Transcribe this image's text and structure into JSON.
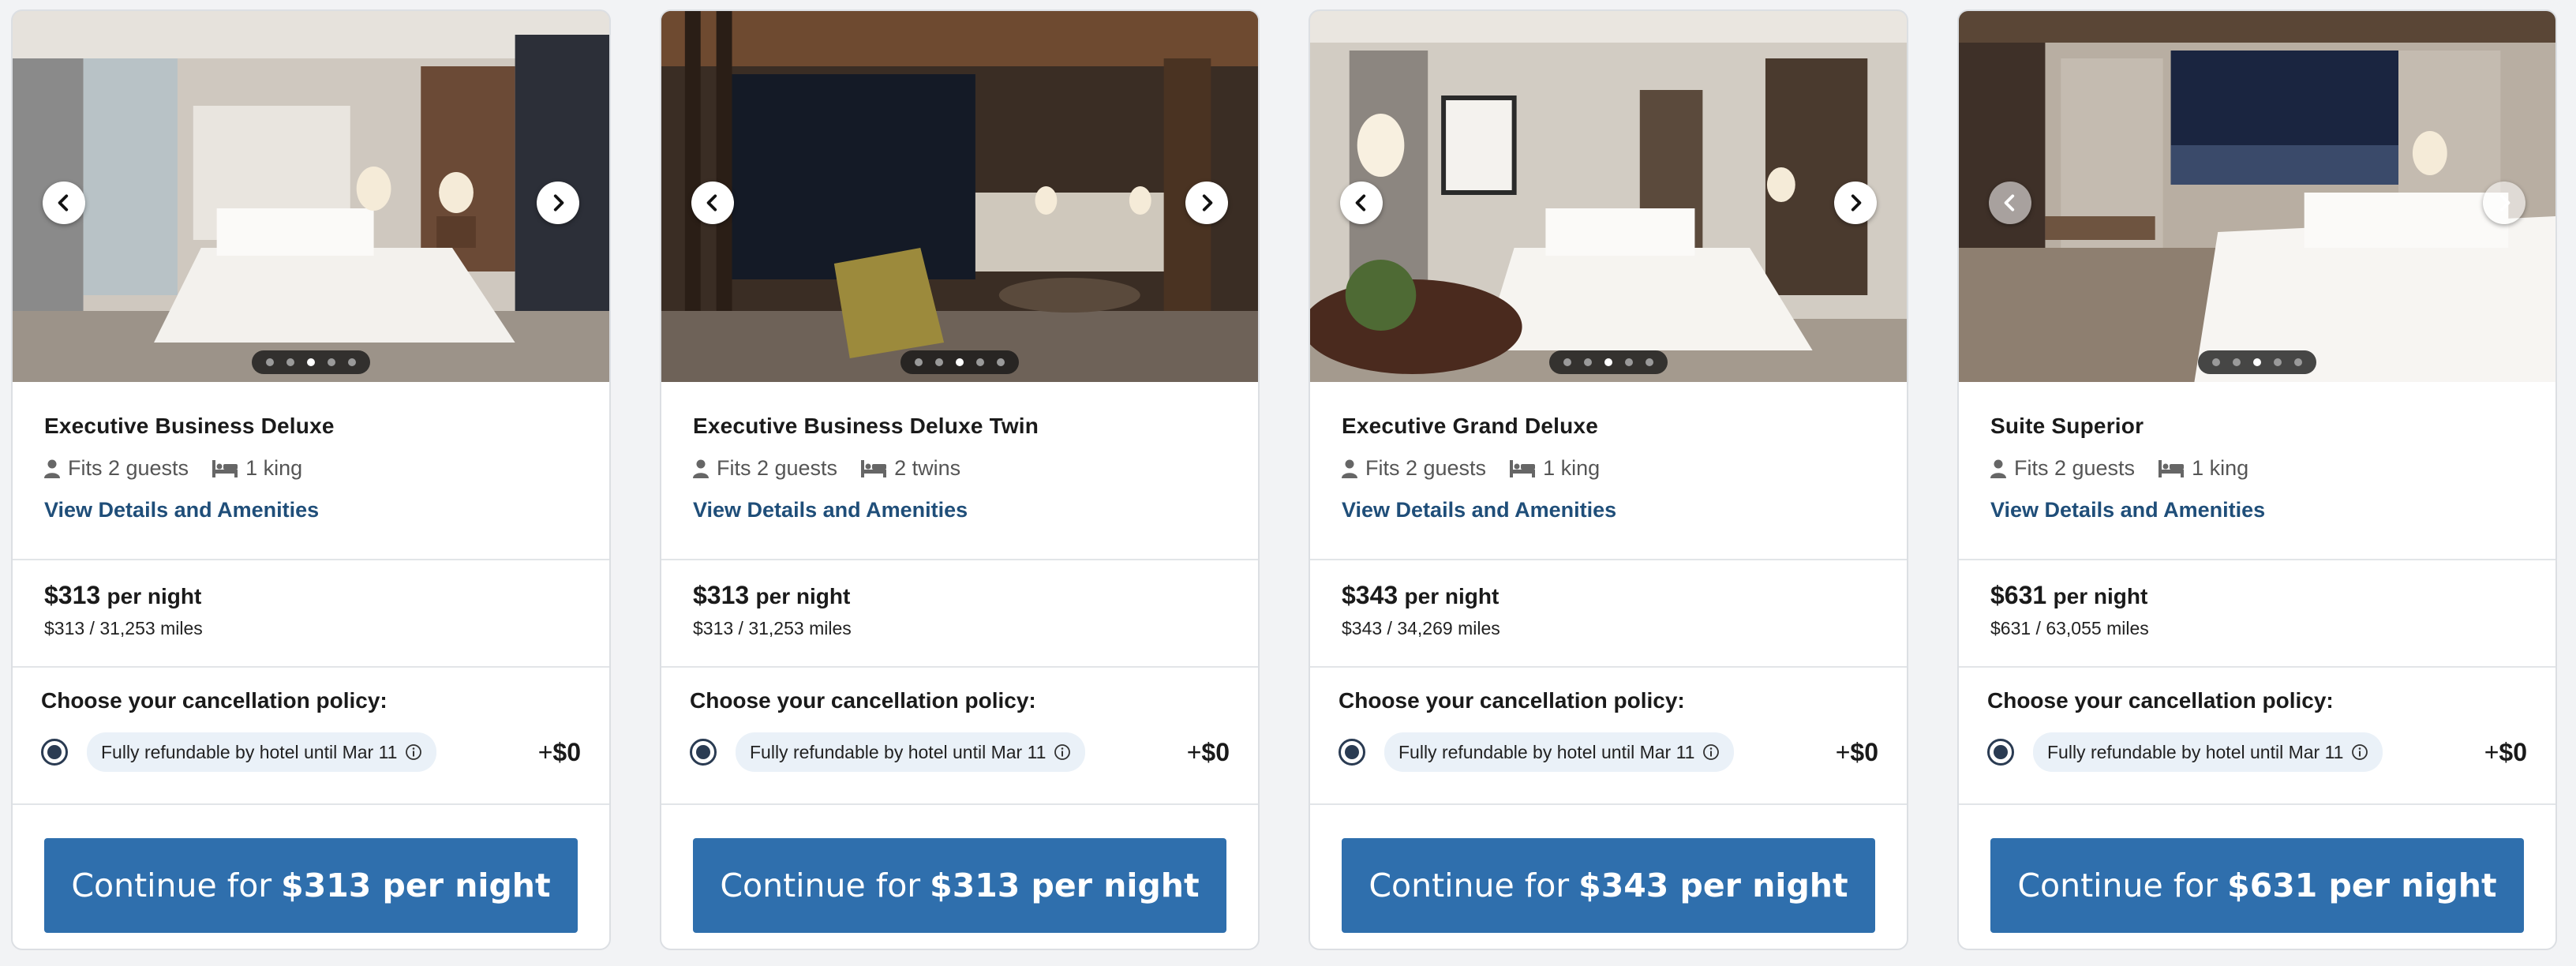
{
  "rooms": [
    {
      "name": "Executive Business Deluxe",
      "guests": "Fits 2 guests",
      "beds": "1 king",
      "details_link": "View Details and Amenities",
      "price": "$313",
      "per_night": "per night",
      "miles": "$313 / 31,253 miles",
      "cancel_title": "Choose your cancellation policy:",
      "policy": "Fully refundable by hotel until Mar 11",
      "addon_sign": "+",
      "addon_value": "$0",
      "cta_prefix": "Continue for",
      "cta_price": "$313 per night",
      "active_dot": 3,
      "dot_count": 5
    },
    {
      "name": "Executive Business Deluxe Twin",
      "guests": "Fits 2 guests",
      "beds": "2 twins",
      "details_link": "View Details and Amenities",
      "price": "$313",
      "per_night": "per night",
      "miles": "$313 / 31,253 miles",
      "cancel_title": "Choose your cancellation policy:",
      "policy": "Fully refundable by hotel until Mar 11",
      "addon_sign": "+",
      "addon_value": "$0",
      "cta_prefix": "Continue for",
      "cta_price": "$313 per night",
      "active_dot": 3,
      "dot_count": 5
    },
    {
      "name": "Executive Grand Deluxe",
      "guests": "Fits 2 guests",
      "beds": "1 king",
      "details_link": "View Details and Amenities",
      "price": "$343",
      "per_night": "per night",
      "miles": "$343 / 34,269 miles",
      "cancel_title": "Choose your cancellation policy:",
      "policy": "Fully refundable by hotel until Mar 11",
      "addon_sign": "+",
      "addon_value": "$0",
      "cta_prefix": "Continue for",
      "cta_price": "$343 per night",
      "active_dot": 3,
      "dot_count": 5
    },
    {
      "name": "Suite Superior",
      "guests": "Fits 2 guests",
      "beds": "1 king",
      "details_link": "View Details and Amenities",
      "price": "$631",
      "per_night": "per night",
      "miles": "$631 / 63,055 miles",
      "cancel_title": "Choose your cancellation policy:",
      "policy": "Fully refundable by hotel until Mar 11",
      "addon_sign": "+",
      "addon_value": "$0",
      "cta_prefix": "Continue for",
      "cta_price": "$631 per night",
      "active_dot": 3,
      "dot_count": 5
    }
  ],
  "icons": {
    "guests": "person-icon",
    "beds": "bed-icon",
    "policy_info": "info-icon",
    "prev": "chevron-left-icon",
    "next": "chevron-right-icon"
  },
  "colors": {
    "cta": "#2f6fad",
    "link": "#1f4e79",
    "pill": "#eaf1f8",
    "radio": "#2a3b52"
  }
}
